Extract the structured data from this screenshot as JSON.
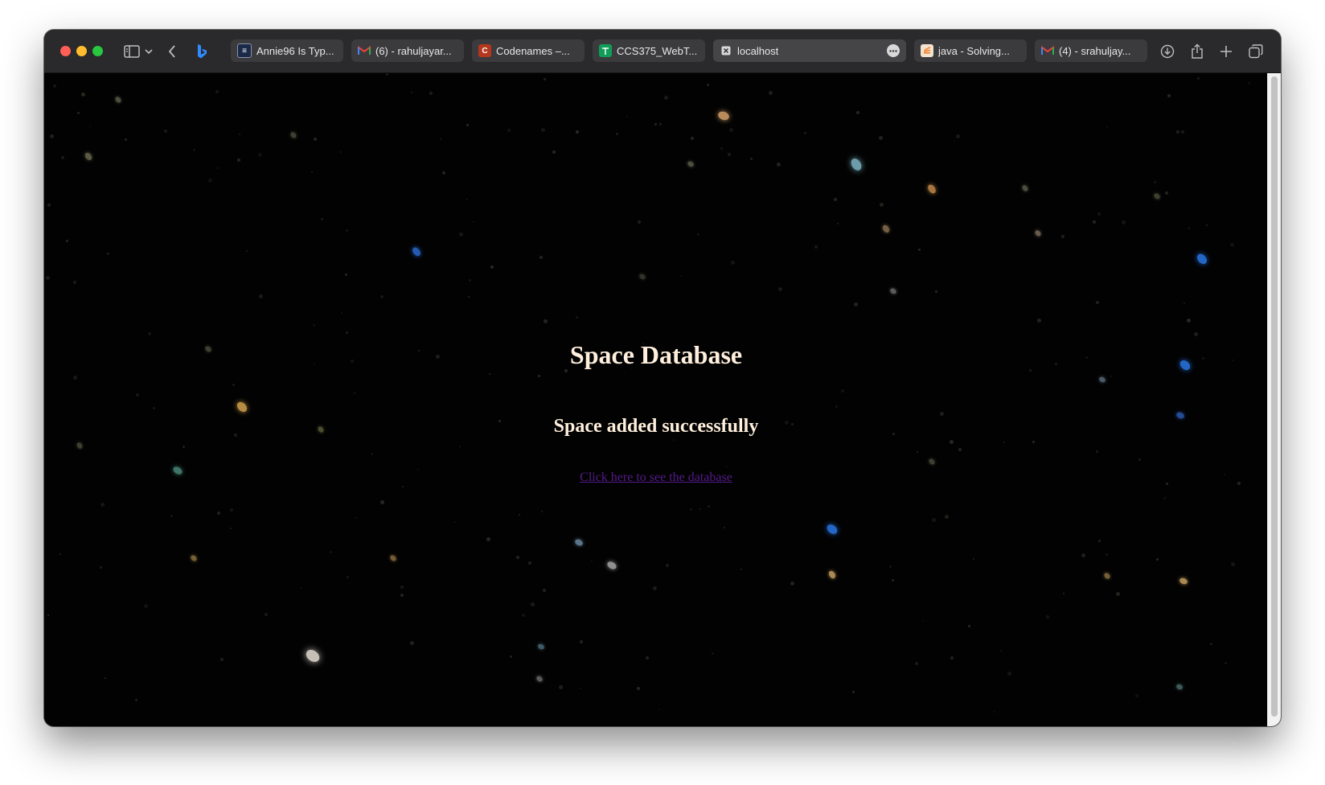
{
  "browser": {
    "tabs": [
      {
        "label": "Annie96 Is Typ...",
        "favicon_color": "#1c2a4a"
      },
      {
        "label": "(6) - rahuljayar...",
        "favicon_color": "#ea4335"
      },
      {
        "label": "Codenames –...",
        "favicon_color": "#b5371e"
      },
      {
        "label": "CCS375_WebT...",
        "favicon_color": "#0f9d58"
      },
      {
        "label": "localhost",
        "favicon_color": "#3b3b3e",
        "active": true
      },
      {
        "label": "java - Solving...",
        "favicon_color": "#f48024"
      },
      {
        "label": "(4) - srahuljay...",
        "favicon_color": "#ea4335"
      }
    ]
  },
  "page": {
    "title": "Space Database",
    "message": "Space added successfully",
    "link_text": "Click here to see the database",
    "link_color": "#551a8b",
    "text_color": "#ffefdc",
    "background": "starfield"
  }
}
